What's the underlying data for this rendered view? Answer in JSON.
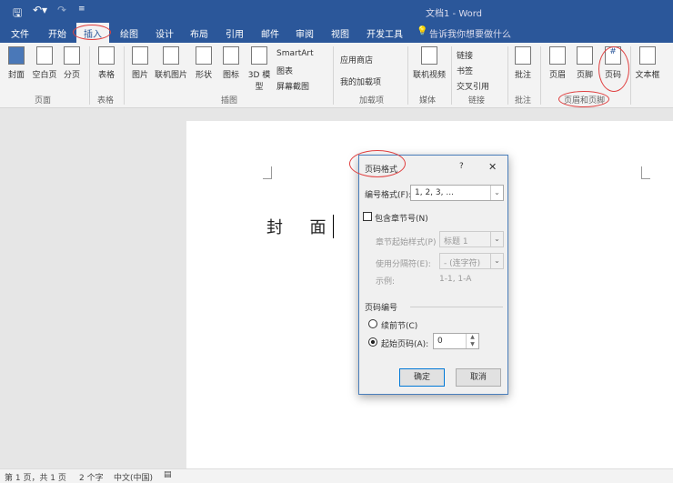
{
  "window": {
    "title": "文档1 - Word"
  },
  "qat": {
    "save_icon": "save-icon",
    "undo_icon": "undo-icon",
    "redo_icon": "redo-icon",
    "customize_icon": "customize-icon"
  },
  "tabs": [
    "文件",
    "开始",
    "插入",
    "绘图",
    "设计",
    "布局",
    "引用",
    "邮件",
    "审阅",
    "视图",
    "开发工具"
  ],
  "tell_me": "告诉我你想要做什么",
  "ribbon": {
    "pages": {
      "cover": "封面",
      "blank": "空白页",
      "break": "分页",
      "group": "页面"
    },
    "tables": {
      "table": "表格",
      "group": "表格"
    },
    "illustrations": {
      "picture": "图片",
      "online_picture": "联机图片",
      "shapes": "形状",
      "icons": "图标",
      "model3d": "3D 模型",
      "smartart": "SmartArt",
      "chart": "图表",
      "screenshot": "屏幕截图",
      "group": "插图"
    },
    "addins": {
      "store": "应用商店",
      "my_addins": "我的加载项",
      "group": "加载项"
    },
    "media": {
      "online_video": "联机视频",
      "group": "媒体"
    },
    "links": {
      "link": "链接",
      "bookmark": "书签",
      "crossref": "交叉引用",
      "group": "链接"
    },
    "comments": {
      "comment": "批注",
      "group": "批注"
    },
    "header_footer": {
      "header": "页眉",
      "footer": "页脚",
      "page_number": "页码",
      "group": "页眉和页脚"
    },
    "text": {
      "textbox": "文本框"
    }
  },
  "document": {
    "text": "封  面"
  },
  "dialog": {
    "title": "页码格式",
    "help": "?",
    "close": "✕",
    "format_label": "编号格式(F):",
    "format_value": "1, 2, 3, ...",
    "include_chapter": "包含章节号(N)",
    "chapter_style_label": "章节起始样式(P)",
    "chapter_style_value": "标题 1",
    "separator_label": "使用分隔符(E):",
    "separator_value": "-  (连字符)",
    "example_label": "示例:",
    "example_value": "1-1, 1-A",
    "section_title": "页码编号",
    "continue_label": "续前节(C)",
    "start_at_label": "起始页码(A):",
    "start_at_value": "0",
    "ok": "确定",
    "cancel": "取消"
  },
  "status": {
    "page": "第 1 页，共 1 页",
    "words": "2 个字",
    "language": "中文(中国)"
  }
}
